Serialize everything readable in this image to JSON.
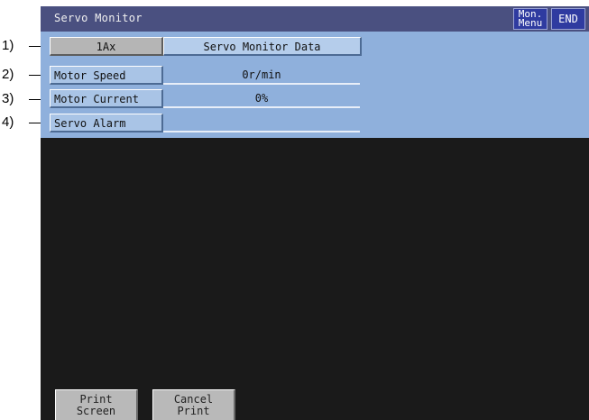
{
  "callouts": [
    "1)",
    "2)",
    "3)",
    "4)"
  ],
  "titlebar": {
    "title": "Servo Monitor",
    "menu_button": {
      "line1": "Mon.",
      "line2": "Menu"
    },
    "end_button": "END"
  },
  "monitor": {
    "axis_button": "1Ax",
    "header": "Servo Monitor Data",
    "rows": [
      {
        "label": "Motor Speed",
        "value": "0r/min"
      },
      {
        "label": "Motor Current",
        "value": "0%"
      },
      {
        "label": "Servo Alarm",
        "value": ""
      }
    ]
  },
  "function_keys": [
    {
      "line1": "Print",
      "line2": "Screen"
    },
    {
      "line1": "Cancel",
      "line2": "Print"
    }
  ],
  "colors": {
    "titlebar": "#4a5080",
    "panel": "#8fb0dc",
    "screen_background": "#1a1a1a",
    "button_blue": "#2f3ba0"
  }
}
